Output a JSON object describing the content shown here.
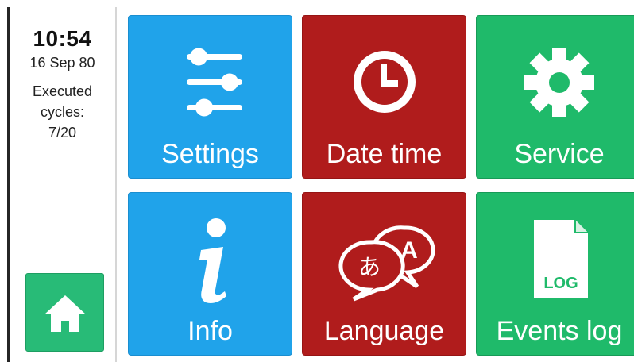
{
  "status": {
    "time": "10:54",
    "date": "16 Sep 80",
    "cycles_label_line1": "Executed",
    "cycles_label_line2": "cycles:",
    "cycles_value": "7/20"
  },
  "home": {
    "icon": "home-icon"
  },
  "tiles": {
    "settings": {
      "label": "Settings",
      "icon": "sliders-icon",
      "color": "#20a3ea"
    },
    "datetime": {
      "label": "Date time",
      "icon": "clock-icon",
      "color": "#b01c1c"
    },
    "service": {
      "label": "Service",
      "icon": "gear-icon",
      "color": "#1fba6a"
    },
    "info": {
      "label": "Info",
      "icon": "info-icon",
      "color": "#20a3ea"
    },
    "language": {
      "label": "Language",
      "icon": "speech-bubbles-icon",
      "color": "#b01c1c"
    },
    "events": {
      "label": "Events log",
      "icon": "log-file-icon",
      "icon_text": "LOG",
      "color": "#1fba6a"
    }
  }
}
